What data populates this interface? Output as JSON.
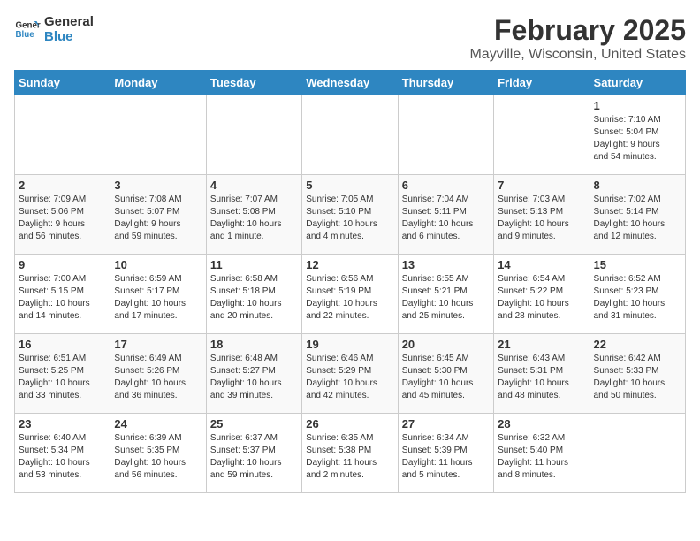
{
  "logo": {
    "line1": "General",
    "line2": "Blue"
  },
  "title": "February 2025",
  "subtitle": "Mayville, Wisconsin, United States",
  "days_of_week": [
    "Sunday",
    "Monday",
    "Tuesday",
    "Wednesday",
    "Thursday",
    "Friday",
    "Saturday"
  ],
  "weeks": [
    [
      {
        "day": "",
        "info": ""
      },
      {
        "day": "",
        "info": ""
      },
      {
        "day": "",
        "info": ""
      },
      {
        "day": "",
        "info": ""
      },
      {
        "day": "",
        "info": ""
      },
      {
        "day": "",
        "info": ""
      },
      {
        "day": "1",
        "info": "Sunrise: 7:10 AM\nSunset: 5:04 PM\nDaylight: 9 hours\nand 54 minutes."
      }
    ],
    [
      {
        "day": "2",
        "info": "Sunrise: 7:09 AM\nSunset: 5:06 PM\nDaylight: 9 hours\nand 56 minutes."
      },
      {
        "day": "3",
        "info": "Sunrise: 7:08 AM\nSunset: 5:07 PM\nDaylight: 9 hours\nand 59 minutes."
      },
      {
        "day": "4",
        "info": "Sunrise: 7:07 AM\nSunset: 5:08 PM\nDaylight: 10 hours\nand 1 minute."
      },
      {
        "day": "5",
        "info": "Sunrise: 7:05 AM\nSunset: 5:10 PM\nDaylight: 10 hours\nand 4 minutes."
      },
      {
        "day": "6",
        "info": "Sunrise: 7:04 AM\nSunset: 5:11 PM\nDaylight: 10 hours\nand 6 minutes."
      },
      {
        "day": "7",
        "info": "Sunrise: 7:03 AM\nSunset: 5:13 PM\nDaylight: 10 hours\nand 9 minutes."
      },
      {
        "day": "8",
        "info": "Sunrise: 7:02 AM\nSunset: 5:14 PM\nDaylight: 10 hours\nand 12 minutes."
      }
    ],
    [
      {
        "day": "9",
        "info": "Sunrise: 7:00 AM\nSunset: 5:15 PM\nDaylight: 10 hours\nand 14 minutes."
      },
      {
        "day": "10",
        "info": "Sunrise: 6:59 AM\nSunset: 5:17 PM\nDaylight: 10 hours\nand 17 minutes."
      },
      {
        "day": "11",
        "info": "Sunrise: 6:58 AM\nSunset: 5:18 PM\nDaylight: 10 hours\nand 20 minutes."
      },
      {
        "day": "12",
        "info": "Sunrise: 6:56 AM\nSunset: 5:19 PM\nDaylight: 10 hours\nand 22 minutes."
      },
      {
        "day": "13",
        "info": "Sunrise: 6:55 AM\nSunset: 5:21 PM\nDaylight: 10 hours\nand 25 minutes."
      },
      {
        "day": "14",
        "info": "Sunrise: 6:54 AM\nSunset: 5:22 PM\nDaylight: 10 hours\nand 28 minutes."
      },
      {
        "day": "15",
        "info": "Sunrise: 6:52 AM\nSunset: 5:23 PM\nDaylight: 10 hours\nand 31 minutes."
      }
    ],
    [
      {
        "day": "16",
        "info": "Sunrise: 6:51 AM\nSunset: 5:25 PM\nDaylight: 10 hours\nand 33 minutes."
      },
      {
        "day": "17",
        "info": "Sunrise: 6:49 AM\nSunset: 5:26 PM\nDaylight: 10 hours\nand 36 minutes."
      },
      {
        "day": "18",
        "info": "Sunrise: 6:48 AM\nSunset: 5:27 PM\nDaylight: 10 hours\nand 39 minutes."
      },
      {
        "day": "19",
        "info": "Sunrise: 6:46 AM\nSunset: 5:29 PM\nDaylight: 10 hours\nand 42 minutes."
      },
      {
        "day": "20",
        "info": "Sunrise: 6:45 AM\nSunset: 5:30 PM\nDaylight: 10 hours\nand 45 minutes."
      },
      {
        "day": "21",
        "info": "Sunrise: 6:43 AM\nSunset: 5:31 PM\nDaylight: 10 hours\nand 48 minutes."
      },
      {
        "day": "22",
        "info": "Sunrise: 6:42 AM\nSunset: 5:33 PM\nDaylight: 10 hours\nand 50 minutes."
      }
    ],
    [
      {
        "day": "23",
        "info": "Sunrise: 6:40 AM\nSunset: 5:34 PM\nDaylight: 10 hours\nand 53 minutes."
      },
      {
        "day": "24",
        "info": "Sunrise: 6:39 AM\nSunset: 5:35 PM\nDaylight: 10 hours\nand 56 minutes."
      },
      {
        "day": "25",
        "info": "Sunrise: 6:37 AM\nSunset: 5:37 PM\nDaylight: 10 hours\nand 59 minutes."
      },
      {
        "day": "26",
        "info": "Sunrise: 6:35 AM\nSunset: 5:38 PM\nDaylight: 11 hours\nand 2 minutes."
      },
      {
        "day": "27",
        "info": "Sunrise: 6:34 AM\nSunset: 5:39 PM\nDaylight: 11 hours\nand 5 minutes."
      },
      {
        "day": "28",
        "info": "Sunrise: 6:32 AM\nSunset: 5:40 PM\nDaylight: 11 hours\nand 8 minutes."
      },
      {
        "day": "",
        "info": ""
      }
    ]
  ]
}
